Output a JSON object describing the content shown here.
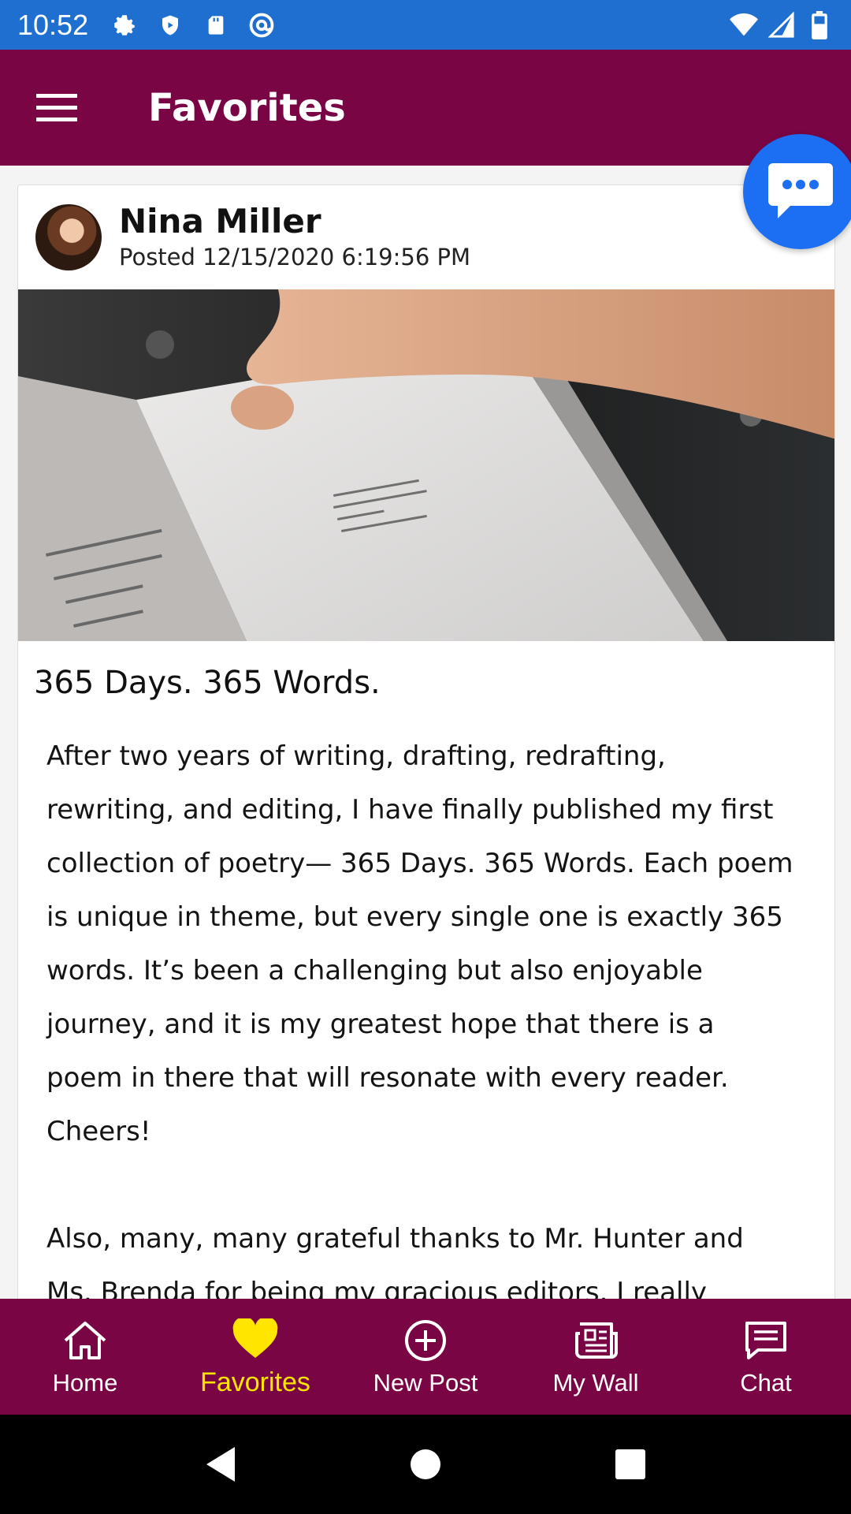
{
  "status_bar": {
    "time": "10:52",
    "left_icons": [
      "gear-icon",
      "shield-icon",
      "sd-card-icon",
      "at-sign-icon"
    ],
    "right_icons": [
      "wifi-icon",
      "cell-signal-icon",
      "battery-icon"
    ]
  },
  "app_bar": {
    "title": "Favorites",
    "menu_icon": "hamburger-menu-icon"
  },
  "post": {
    "author": "Nina Miller",
    "posted": "Posted 12/15/2020 6:19:56 PM",
    "title": "365 Days. 365 Words.",
    "body": [
      "After two years of writing, drafting, redrafting, rewriting, and editing, I have finally published my first collection of poetry— 365 Days. 365 Words. Each poem is unique in theme, but every single one is exactly 365 words. It’s been a challenging but also enjoyable journey, and it is my greatest hope that there is a poem in there that will resonate with every reader. Cheers!",
      "Also, many, many grateful thanks to Mr. Hunter and Ms. Brenda for being my gracious editors. I really"
    ]
  },
  "chat_fab": {
    "icon": "chat-bubble-icon"
  },
  "bottom_nav": {
    "items": [
      {
        "label": "Home",
        "icon": "home-icon",
        "active": false
      },
      {
        "label": "Favorites",
        "icon": "heart-icon",
        "active": true
      },
      {
        "label": "New Post",
        "icon": "plus-circle-icon",
        "active": false
      },
      {
        "label": "My Wall",
        "icon": "newspaper-icon",
        "active": false
      },
      {
        "label": "Chat",
        "icon": "chat-icon",
        "active": false
      }
    ]
  },
  "colors": {
    "status_bar": "#1e6fcf",
    "primary": "#7a0545",
    "active_nav": "#ffe600",
    "fab": "#1c6ff2"
  }
}
